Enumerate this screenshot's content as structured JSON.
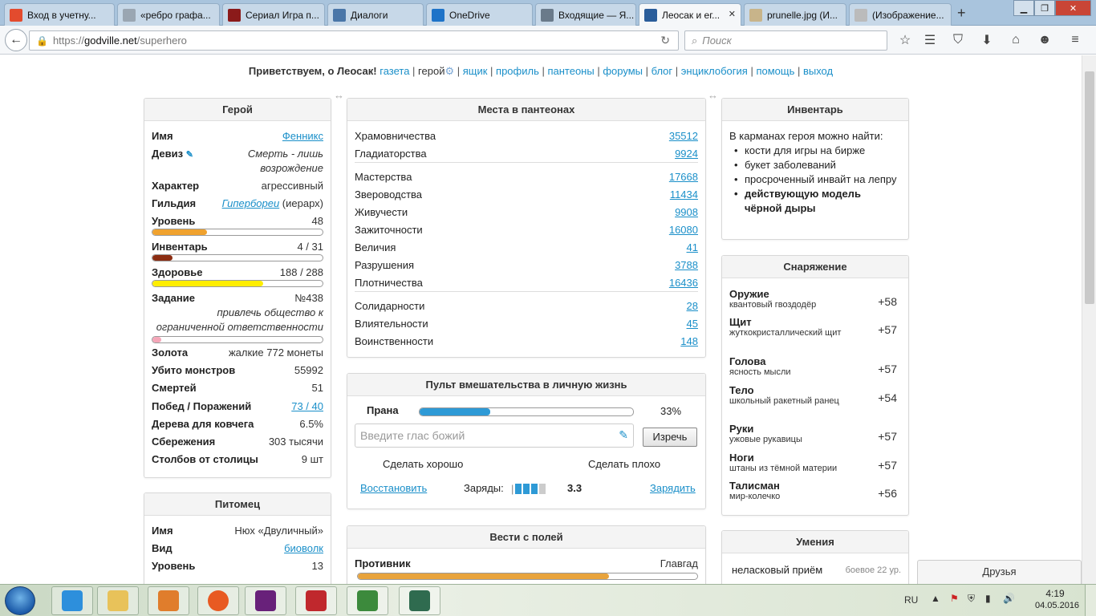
{
  "browser": {
    "tabs": [
      {
        "title": "Вход в учетну...",
        "icon": "microsoft-icon",
        "color": "#e34b2e"
      },
      {
        "title": "«ребро графа...",
        "icon": "page-icon",
        "color": "#9aa6b2"
      },
      {
        "title": "Сериал Игра п...",
        "icon": "kinopoisk-icon",
        "color": "#8b1a1a"
      },
      {
        "title": "Диалоги",
        "icon": "vk-icon",
        "color": "#4a76a8"
      },
      {
        "title": "OneDrive",
        "icon": "onedrive-icon",
        "color": "#1e73c8"
      },
      {
        "title": "Входящие — Я...",
        "icon": "mail-icon",
        "color": "#6a7a8a"
      },
      {
        "title": "Леосак и ег...",
        "icon": "godville-icon",
        "color": "#2a5d9a",
        "active": true
      },
      {
        "title": "prunelle.jpg (И...",
        "icon": "image-icon",
        "color": "#c8b48a"
      },
      {
        "title": "(Изображение...",
        "icon": "image-icon",
        "color": "#bbb"
      }
    ],
    "url_scheme": "https://",
    "url_host": "godville.net",
    "url_path": "/superhero",
    "search_placeholder": "Поиск"
  },
  "greeting": {
    "text": "Приветствуем, о Леосак!",
    "links": [
      "газета",
      "герой",
      "ящик",
      "профиль",
      "пантеоны",
      "форумы",
      "блог",
      "энциклобогия",
      "помощь",
      "выход"
    ]
  },
  "hero": {
    "title": "Герой",
    "name_label": "Имя",
    "name": "Фенникс",
    "motto_label": "Девиз",
    "motto": "Смерть - лишь возрождение",
    "character_label": "Характер",
    "character": "агрессивный",
    "guild_label": "Гильдия",
    "guild": "Гипербореи",
    "guild_rank": "(иерарх)",
    "level_label": "Уровень",
    "level": "48",
    "level_progress": 0.32,
    "inventory_label": "Инвентарь",
    "inventory": "4 / 31",
    "inventory_progress": 0.12,
    "health_label": "Здоровье",
    "health": "188 / 288",
    "health_progress": 0.65,
    "quest_label": "Задание",
    "quest_number": "№438",
    "quest_text": "привлечь общество к ограниченной ответственности",
    "quest_progress": 0.05,
    "gold_label": "Золота",
    "gold": "жалкие 772 монеты",
    "monsters_label": "Убито монстров",
    "monsters": "55992",
    "deaths_label": "Смертей",
    "deaths": "51",
    "wins_label": "Побед / Поражений",
    "wins": "73 / 40",
    "ark_label": "Дерева для ковчега",
    "ark": "6.5%",
    "savings_label": "Сбережения",
    "savings": "303 тысячи",
    "pillars_label": "Столбов от столицы",
    "pillars": "9 шт"
  },
  "pet": {
    "title": "Питомец",
    "name_label": "Имя",
    "name": "Нюх «Двуличный»",
    "type_label": "Вид",
    "type": "биоволк",
    "level_label": "Уровень",
    "level": "13"
  },
  "pantheons": {
    "title": "Места в пантеонах",
    "groups": [
      [
        {
          "name": "Храмовничества",
          "value": "35512"
        },
        {
          "name": "Гладиаторства",
          "value": "9924"
        }
      ],
      [
        {
          "name": "Мастерства",
          "value": "17668"
        },
        {
          "name": "Звероводства",
          "value": "11434"
        },
        {
          "name": "Живучести",
          "value": "9908"
        },
        {
          "name": "Зажиточности",
          "value": "16080"
        },
        {
          "name": "Величия",
          "value": "41"
        },
        {
          "name": "Разрушения",
          "value": "3788"
        },
        {
          "name": "Плотничества",
          "value": "16436"
        }
      ],
      [
        {
          "name": "Солидарности",
          "value": "28"
        },
        {
          "name": "Влиятельности",
          "value": "45"
        },
        {
          "name": "Воинственности",
          "value": "148"
        }
      ]
    ]
  },
  "remote": {
    "title": "Пульт вмешательства в личную жизнь",
    "prana_label": "Прана",
    "prana_percent": "33%",
    "prana_progress": 0.33,
    "voice_placeholder": "Введите глас божий",
    "voice_button": "Изречь",
    "good": "Сделать хорошо",
    "bad": "Сделать плохо",
    "restore": "Восстановить",
    "charges_label": "Заряды:",
    "charges_value": "3.3",
    "charges_filled": 3,
    "charge": "Зарядить"
  },
  "news": {
    "title": "Вести с полей",
    "enemy_label": "Противник",
    "enemy": "Главгад",
    "enemy_progress": 0.74
  },
  "inventory": {
    "title": "Инвентарь",
    "intro": "В карманах героя можно найти:",
    "items": [
      "кости для игры на бирже",
      "букет заболеваний",
      "просроченный инвайт на лепру"
    ],
    "bold_item": "действующую модель чёрной дыры"
  },
  "equipment": {
    "title": "Снаряжение",
    "items": [
      {
        "slot": "Оружие",
        "name": "квантовый гвоздодёр",
        "bonus": "+58"
      },
      {
        "slot": "Щит",
        "name": "жуткокристаллический щит",
        "bonus": "+57"
      },
      {
        "slot": "Голова",
        "name": "ясность мысли",
        "bonus": "+57"
      },
      {
        "slot": "Тело",
        "name": "школьный ракетный ранец",
        "bonus": "+54"
      },
      {
        "slot": "Руки",
        "name": "ужовые рукавицы",
        "bonus": "+57"
      },
      {
        "slot": "Ноги",
        "name": "штаны из тёмной материи",
        "bonus": "+57"
      },
      {
        "slot": "Талисман",
        "name": "мир-колечко",
        "bonus": "+56"
      }
    ]
  },
  "skills": {
    "title": "Умения",
    "first": "неласковый приём",
    "first_meta": "боевое 22 ур."
  },
  "friends_label": "Друзья",
  "taskbar": {
    "lang": "RU",
    "time": "4:19",
    "date": "04.05.2016"
  }
}
